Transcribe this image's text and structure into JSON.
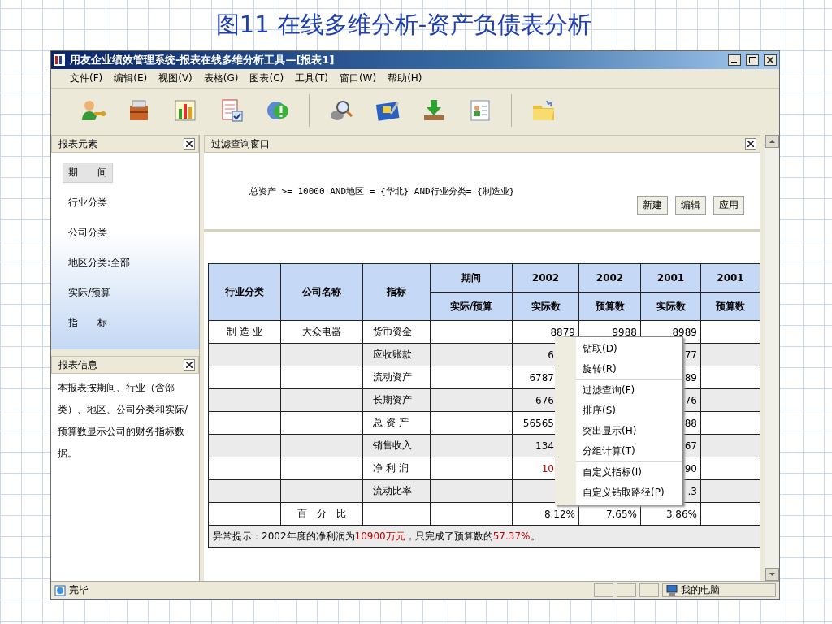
{
  "slide_title": "图11 在线多维分析-资产负债表分析",
  "window": {
    "title": "用友企业绩效管理系统-报表在线多维分析工具—[报表1]"
  },
  "menu_bar": [
    "文件(F)",
    "编辑(E)",
    "视图(V)",
    "表格(G)",
    "图表(C)",
    "工具(T)",
    "窗口(W)",
    "帮助(H)"
  ],
  "elements_panel": {
    "title": "报表元素",
    "items": [
      {
        "label": "期　　间",
        "selected": true
      },
      {
        "label": "行业分类",
        "selected": false
      },
      {
        "label": "公司分类",
        "selected": false
      },
      {
        "label": "地区分类:全部",
        "selected": false
      },
      {
        "label": "实际/预算",
        "selected": false
      },
      {
        "label": "指　　标",
        "selected": false
      }
    ]
  },
  "info_panel": {
    "title": "报表信息",
    "text": "本报表按期间、行业（含部类）、地区、公司分类和实际/预算数显示公司的财务指标数据。"
  },
  "filter_panel": {
    "title": "过滤查询窗口",
    "condition": "总资产 >= 10000 AND地区 = {华北} AND行业分类= {制造业}",
    "buttons": [
      "新建",
      "编辑",
      "应用"
    ]
  },
  "table": {
    "columns": [
      "行业分类",
      "公司名称",
      "指标"
    ],
    "period_header": {
      "top": "期间",
      "bottom": "实际/预算"
    },
    "value_columns": [
      {
        "year": "2002",
        "type": "实际数"
      },
      {
        "year": "2002",
        "type": "预算数"
      },
      {
        "year": "2001",
        "type": "实际数"
      },
      {
        "year": "2001",
        "type": "预算数"
      }
    ],
    "rows": [
      {
        "industry": "制 造 业",
        "company": "大众电器",
        "indicator": "货币资金",
        "actual_2002": "8879",
        "alert": false,
        "budget_2002": "9988",
        "actual_2001": "8989"
      },
      {
        "indicator": "应收账款",
        "actual_2002": "6",
        "alert": false,
        "actual_2001": "77"
      },
      {
        "indicator": "流动资产",
        "actual_2002": "6787",
        "alert": false,
        "actual_2001": "89"
      },
      {
        "indicator": "长期资产",
        "actual_2002": "676",
        "alert": false,
        "actual_2001": "76"
      },
      {
        "indicator": "总 资 产",
        "actual_2002": "56565",
        "alert": false,
        "actual_2001": "88"
      },
      {
        "indicator": "销售收入",
        "actual_2002": "134",
        "alert": false,
        "actual_2001": "67"
      },
      {
        "indicator": "净 利 润",
        "actual_2002": "10",
        "alert": true,
        "actual_2001": "90"
      },
      {
        "indicator": "流动比率",
        "actual_2001": ".3"
      },
      {
        "company": "百　分　比",
        "actual_2002": "8.12%",
        "alert": false,
        "budget_2002": "7.65%",
        "actual_2001": "3.86%"
      }
    ],
    "note": [
      {
        "text": "异常提示：2002年度的净利润为",
        "alert": false
      },
      {
        "text": "10900万元",
        "alert": true
      },
      {
        "text": "，只完成了预算数的",
        "alert": false
      },
      {
        "text": "57.37%",
        "alert": true
      },
      {
        "text": "。",
        "alert": false
      }
    ]
  },
  "context_menu": [
    [
      "钻取(D)",
      "旋转(R)"
    ],
    [
      "过滤查询(F)",
      "排序(S)",
      "突出显示(H)",
      "分组计算(T)"
    ],
    [
      "自定义指标(I)",
      "自定义钻取路径(P)"
    ]
  ],
  "status_bar": {
    "text": "完毕",
    "zone": "我的电脑"
  }
}
